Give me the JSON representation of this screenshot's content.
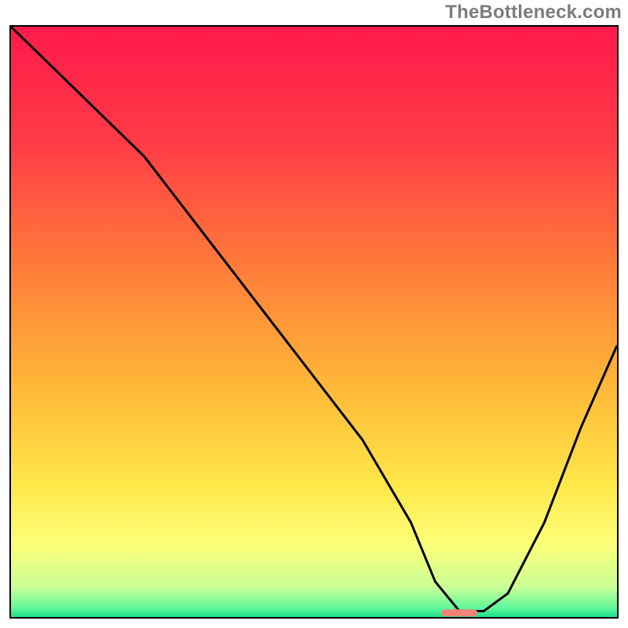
{
  "watermark": "TheBottleneck.com",
  "axes_border_color": "#000000",
  "chart_data": {
    "type": "line",
    "title": "",
    "xlabel": "",
    "ylabel": "",
    "xlim": [
      0,
      100
    ],
    "ylim": [
      0,
      100
    ],
    "background_gradient_stops": [
      {
        "offset": 0.0,
        "color": "#ff1a4b"
      },
      {
        "offset": 0.2,
        "color": "#ff3c46"
      },
      {
        "offset": 0.4,
        "color": "#ff7a3a"
      },
      {
        "offset": 0.6,
        "color": "#ffb537"
      },
      {
        "offset": 0.78,
        "color": "#ffe84a"
      },
      {
        "offset": 0.88,
        "color": "#fbff7a"
      },
      {
        "offset": 0.95,
        "color": "#c8ff97"
      },
      {
        "offset": 0.985,
        "color": "#5ef79a"
      },
      {
        "offset": 1.0,
        "color": "#1ee08a"
      }
    ],
    "series": [
      {
        "name": "bottleneck-curve",
        "color": "#000000",
        "x": [
          0,
          12,
          22,
          34,
          46,
          58,
          66,
          70,
          74,
          78,
          82,
          88,
          94,
          100
        ],
        "values": [
          100,
          88,
          78,
          62,
          46,
          30,
          16,
          6,
          1,
          1,
          4,
          16,
          32,
          46
        ]
      }
    ],
    "marker": {
      "name": "optimal-region",
      "color": "#f08474",
      "x_center": 74,
      "y": 0.7,
      "width_x": 6,
      "height_y": 1.2,
      "radius_px": 6
    }
  }
}
